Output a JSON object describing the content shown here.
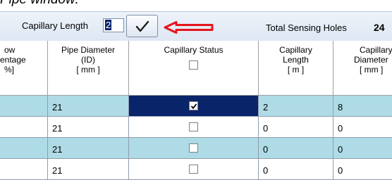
{
  "caption": "Pipe window:",
  "toolbar": {
    "capillary_length_label": "Capillary Length",
    "capillary_length_value": "2",
    "apply_icon": "checkmark-icon",
    "total_sensing_holes_label": "Total Sensing Holes",
    "total_sensing_holes_value": "24",
    "annotation_arrow_color": "#e8141c"
  },
  "table": {
    "headers": [
      {
        "lines": [
          "ow",
          "entage",
          "%]"
        ]
      },
      {
        "lines": [
          "Pipe Diameter",
          "(ID)",
          "[ mm ]"
        ]
      },
      {
        "lines": [
          "Capillary Status"
        ],
        "checkbox": true,
        "checked": false
      },
      {
        "lines": [
          "Capillary",
          "Length",
          "[ m ]"
        ]
      },
      {
        "lines": [
          "Capillary",
          "Diameter",
          "[ mm ]"
        ]
      }
    ],
    "rows": [
      {
        "pipe_diameter": "21",
        "capillary_status": true,
        "capillary_length": "2",
        "capillary_diameter": "8"
      },
      {
        "pipe_diameter": "21",
        "capillary_status": false,
        "capillary_length": "0",
        "capillary_diameter": "0"
      },
      {
        "pipe_diameter": "21",
        "capillary_status": false,
        "capillary_length": "0",
        "capillary_diameter": "0"
      },
      {
        "pipe_diameter": "21",
        "capillary_status": false,
        "capillary_length": "0",
        "capillary_diameter": "0"
      }
    ]
  },
  "colors": {
    "row_alt": "#aedbe6",
    "selected_cell": "#0a246a",
    "toolbar": "#dde6f2"
  }
}
